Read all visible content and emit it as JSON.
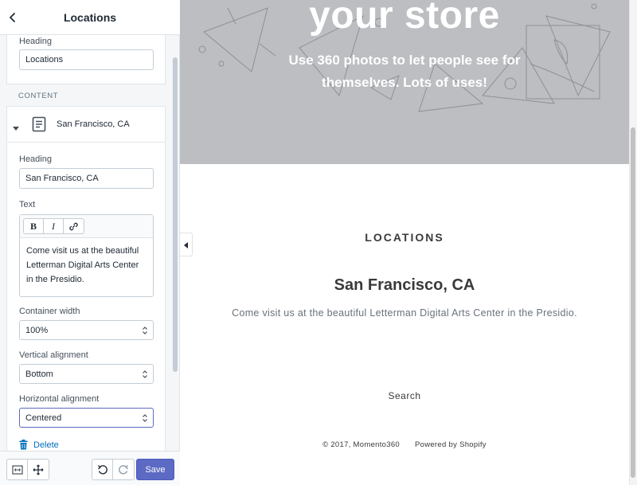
{
  "sidebar": {
    "title": "Locations",
    "heading_field": {
      "label": "Heading",
      "value": "Locations"
    },
    "section_label": "CONTENT",
    "block": {
      "name": "San Francisco, CA",
      "heading_label": "Heading",
      "heading_value": "San Francisco, CA",
      "text_label": "Text",
      "text_toolbar": {
        "bold": "B",
        "italic": "I"
      },
      "text_value": "Come visit us at the beautiful Letterman Digital Arts Center in the Presidio.",
      "container_width": {
        "label": "Container width",
        "value": "100%"
      },
      "vertical_alignment": {
        "label": "Vertical alignment",
        "value": "Bottom"
      },
      "horizontal_alignment": {
        "label": "Horizontal alignment",
        "value": "Centered"
      },
      "delete_label": "Delete"
    },
    "footer": {
      "save_label": "Save"
    }
  },
  "preview": {
    "hero": {
      "title": "your store",
      "subtitle": "Use 360 photos to let people see for themselves. Lots of uses!"
    },
    "section_title": "LOCATIONS",
    "location_name": "San Francisco, CA",
    "location_text": "Come visit us at the beautiful Letterman Digital Arts Center in the Presidio.",
    "search_link": "Search",
    "copyright": "© 2017, Momento360",
    "powered_by": "Powered by Shopify"
  },
  "colors": {
    "accent": "#5c6ac4",
    "link": "#006fbb",
    "hero_bg": "#bcbec2",
    "sidebar_bg": "#f4f6f8"
  }
}
